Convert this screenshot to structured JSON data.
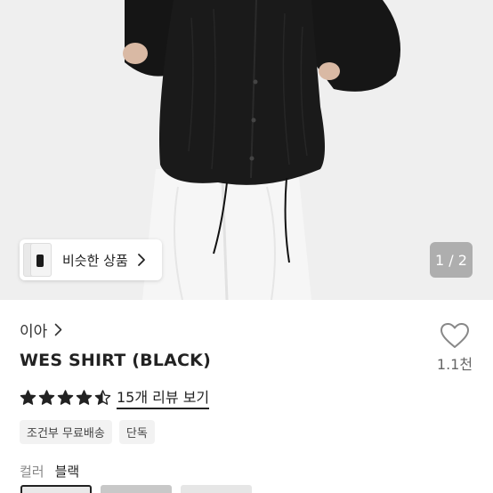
{
  "gallery": {
    "similar_label": "비슷한 상품",
    "page_current": "1",
    "page_sep": " / ",
    "page_total": "2"
  },
  "product": {
    "brand": "이아",
    "title": "WES SHIRT (BLACK)",
    "rating": 4.5,
    "review_text": "15개 리뷰 보기",
    "like_count": "1.1천",
    "tags": [
      "조건부 무료배송",
      "단독"
    ],
    "option_label": "컬러",
    "option_value": "블랙"
  },
  "colors": {
    "star": "#222222",
    "indicator_bg": "#8a8a8a"
  },
  "icons": [
    "chevron-right-icon",
    "heart-outline-icon",
    "star-icon"
  ]
}
